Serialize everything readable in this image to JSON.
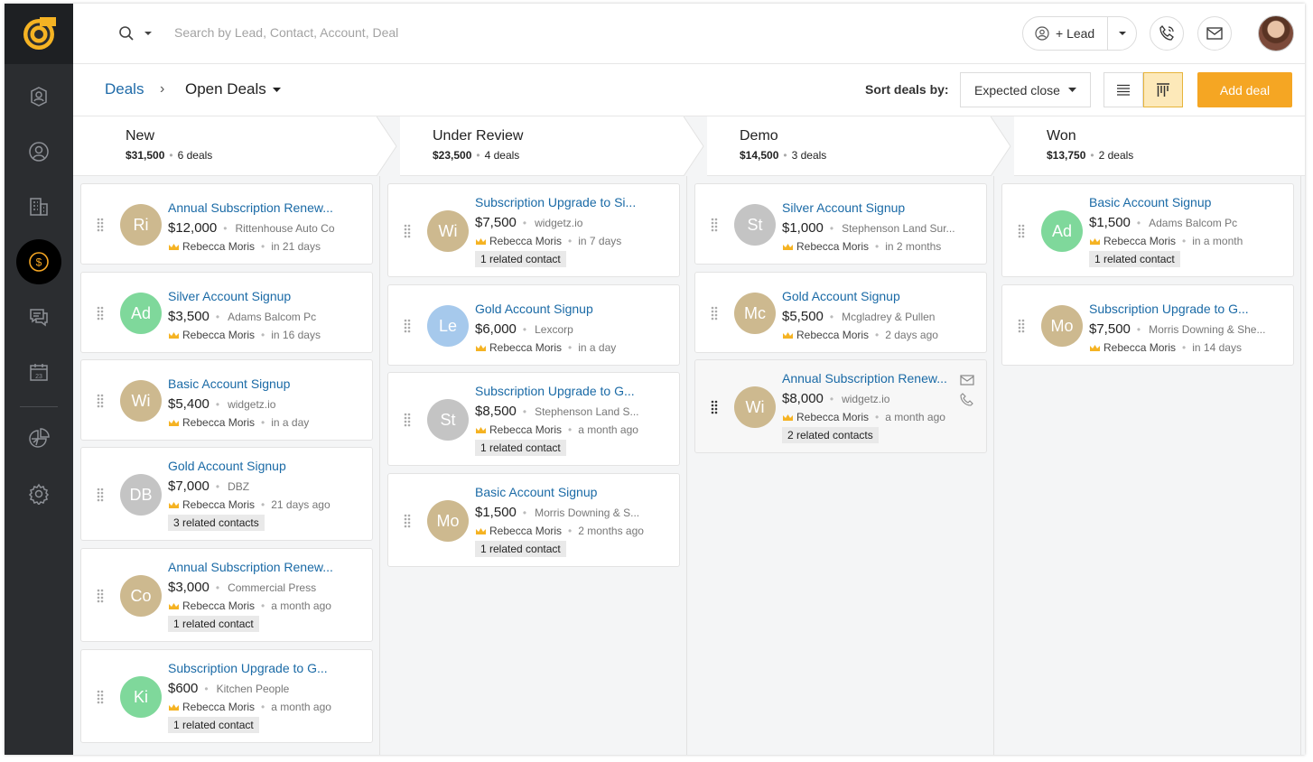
{
  "search": {
    "placeholder": "Search by Lead, Contact, Account, Deal"
  },
  "header": {
    "lead_button": "+ Lead"
  },
  "breadcrumb": {
    "root": "Deals",
    "current": "Open Deals"
  },
  "toolbar": {
    "sort_label": "Sort deals by:",
    "sort_value": "Expected close",
    "add_deal": "Add deal"
  },
  "colors": {
    "accent": "#f5a623",
    "link": "#1a6aa6",
    "sidebar": "#2b2d30"
  },
  "stages": [
    {
      "name": "New",
      "amount": "$31,500",
      "count": "6 deals",
      "cards": [
        {
          "initials": "Ri",
          "color": "tan",
          "title": "Annual Subscription Renew...",
          "value": "$12,000",
          "company": "Rittenhouse Auto Co",
          "owner": "Rebecca Moris",
          "when": "in 21 days",
          "contacts": ""
        },
        {
          "initials": "Ad",
          "color": "green",
          "title": "Silver Account Signup",
          "value": "$3,500",
          "company": "Adams Balcom Pc",
          "owner": "Rebecca Moris",
          "when": "in 16 days",
          "contacts": ""
        },
        {
          "initials": "Wi",
          "color": "tan",
          "title": "Basic Account Signup",
          "value": "$5,400",
          "company": "widgetz.io",
          "owner": "Rebecca Moris",
          "when": "in a day",
          "contacts": ""
        },
        {
          "initials": "DB",
          "color": "gray",
          "title": "Gold Account Signup",
          "value": "$7,000",
          "company": "DBZ",
          "owner": "Rebecca Moris",
          "when": "21 days ago",
          "contacts": "3 related contacts"
        },
        {
          "initials": "Co",
          "color": "tan",
          "title": "Annual Subscription Renew...",
          "value": "$3,000",
          "company": "Commercial Press",
          "owner": "Rebecca Moris",
          "when": "a month ago",
          "contacts": "1 related contact"
        },
        {
          "initials": "Ki",
          "color": "green",
          "title": "Subscription Upgrade to G...",
          "value": "$600",
          "company": "Kitchen People",
          "owner": "Rebecca Moris",
          "when": "a month ago",
          "contacts": "1 related contact"
        }
      ]
    },
    {
      "name": "Under Review",
      "amount": "$23,500",
      "count": "4 deals",
      "cards": [
        {
          "initials": "Wi",
          "color": "tan",
          "title": "Subscription Upgrade to Si...",
          "value": "$7,500",
          "company": "widgetz.io",
          "owner": "Rebecca Moris",
          "when": "in 7 days",
          "contacts": "1 related contact"
        },
        {
          "initials": "Le",
          "color": "blue",
          "title": "Gold Account Signup",
          "value": "$6,000",
          "company": "Lexcorp",
          "owner": "Rebecca Moris",
          "when": "in a day",
          "contacts": ""
        },
        {
          "initials": "St",
          "color": "gray",
          "title": "Subscription Upgrade to G...",
          "value": "$8,500",
          "company": "Stephenson Land S...",
          "owner": "Rebecca Moris",
          "when": "a month ago",
          "contacts": "1 related contact"
        },
        {
          "initials": "Mo",
          "color": "tan",
          "title": "Basic Account Signup",
          "value": "$1,500",
          "company": "Morris Downing & S...",
          "owner": "Rebecca Moris",
          "when": "2 months ago",
          "contacts": "1 related contact"
        }
      ]
    },
    {
      "name": "Demo",
      "amount": "$14,500",
      "count": "3 deals",
      "cards": [
        {
          "initials": "St",
          "color": "gray",
          "title": "Silver Account Signup",
          "value": "$1,000",
          "company": "Stephenson Land Sur...",
          "owner": "Rebecca Moris",
          "when": "in 2 months",
          "contacts": ""
        },
        {
          "initials": "Mc",
          "color": "tan",
          "title": "Gold Account Signup",
          "value": "$5,500",
          "company": "Mcgladrey & Pullen",
          "owner": "Rebecca Moris",
          "when": "2 days ago",
          "contacts": ""
        },
        {
          "initials": "Wi",
          "color": "tan",
          "title": "Annual Subscription Renew...",
          "value": "$8,000",
          "company": "widgetz.io",
          "owner": "Rebecca Moris",
          "when": "a month ago",
          "contacts": "2 related contacts"
        }
      ]
    },
    {
      "name": "Won",
      "amount": "$13,750",
      "count": "2 deals",
      "cards": [
        {
          "initials": "Ad",
          "color": "green",
          "title": "Basic Account Signup",
          "value": "$1,500",
          "company": "Adams Balcom Pc",
          "owner": "Rebecca Moris",
          "when": "in a month",
          "contacts": "1 related contact"
        },
        {
          "initials": "Mo",
          "color": "tan",
          "title": "Subscription Upgrade to G...",
          "value": "$7,500",
          "company": "Morris Downing & She...",
          "owner": "Rebecca Moris",
          "when": "in 14 days",
          "contacts": ""
        }
      ]
    }
  ]
}
